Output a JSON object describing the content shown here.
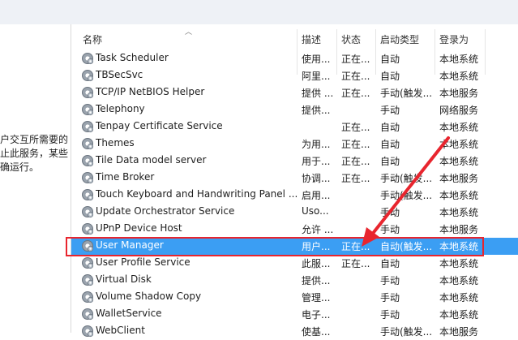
{
  "left_pane": {
    "lines": [
      "户交互所需要的",
      "止此服务，某些",
      "确运行。"
    ]
  },
  "columns": {
    "name": "名称",
    "desc": "描述",
    "status": "状态",
    "startup": "启动类型",
    "logon": "登录为"
  },
  "services": [
    {
      "name": "Task Scheduler",
      "desc": "使用...",
      "status": "正在...",
      "startup": "自动",
      "logon": "本地系统"
    },
    {
      "name": "TBSecSvc",
      "desc": "阿里...",
      "status": "正在...",
      "startup": "自动",
      "logon": "本地系统"
    },
    {
      "name": "TCP/IP NetBIOS Helper",
      "desc": "提供 ...",
      "status": "正在...",
      "startup": "手动(触发...",
      "logon": "本地服务"
    },
    {
      "name": "Telephony",
      "desc": "提供...",
      "status": "",
      "startup": "手动",
      "logon": "网络服务"
    },
    {
      "name": "Tenpay Certificate Service",
      "desc": "",
      "status": "正在...",
      "startup": "自动",
      "logon": "本地系统"
    },
    {
      "name": "Themes",
      "desc": "为用...",
      "status": "正在...",
      "startup": "自动",
      "logon": "本地系统"
    },
    {
      "name": "Tile Data model server",
      "desc": "用于...",
      "status": "正在...",
      "startup": "自动",
      "logon": "本地系统"
    },
    {
      "name": "Time Broker",
      "desc": "协调...",
      "status": "正在...",
      "startup": "手动(触发...",
      "logon": "本地服务"
    },
    {
      "name": "Touch Keyboard and Handwriting Panel ...",
      "desc": "启用...",
      "status": "",
      "startup": "手动(触发...",
      "logon": "本地系统"
    },
    {
      "name": "Update Orchestrator Service",
      "desc": "Uso...",
      "status": "",
      "startup": "手动",
      "logon": "本地系统"
    },
    {
      "name": "UPnP Device Host",
      "desc": "允许 ...",
      "status": "",
      "startup": "手动",
      "logon": "本地服务"
    },
    {
      "name": "User Manager",
      "desc": "用户...",
      "status": "正在...",
      "startup": "自动(触发...",
      "logon": "本地系统",
      "selected": true
    },
    {
      "name": "User Profile Service",
      "desc": "此服...",
      "status": "正在...",
      "startup": "自动",
      "logon": "本地系统"
    },
    {
      "name": "Virtual Disk",
      "desc": "提供...",
      "status": "",
      "startup": "手动",
      "logon": "本地系统"
    },
    {
      "name": "Volume Shadow Copy",
      "desc": "管理...",
      "status": "",
      "startup": "手动",
      "logon": "本地系统"
    },
    {
      "name": "WalletService",
      "desc": "电子...",
      "status": "",
      "startup": "手动",
      "logon": "本地系统"
    },
    {
      "name": "WebClient",
      "desc": "使基...",
      "status": "",
      "startup": "手动(触发...",
      "logon": "本地服务"
    }
  ]
}
